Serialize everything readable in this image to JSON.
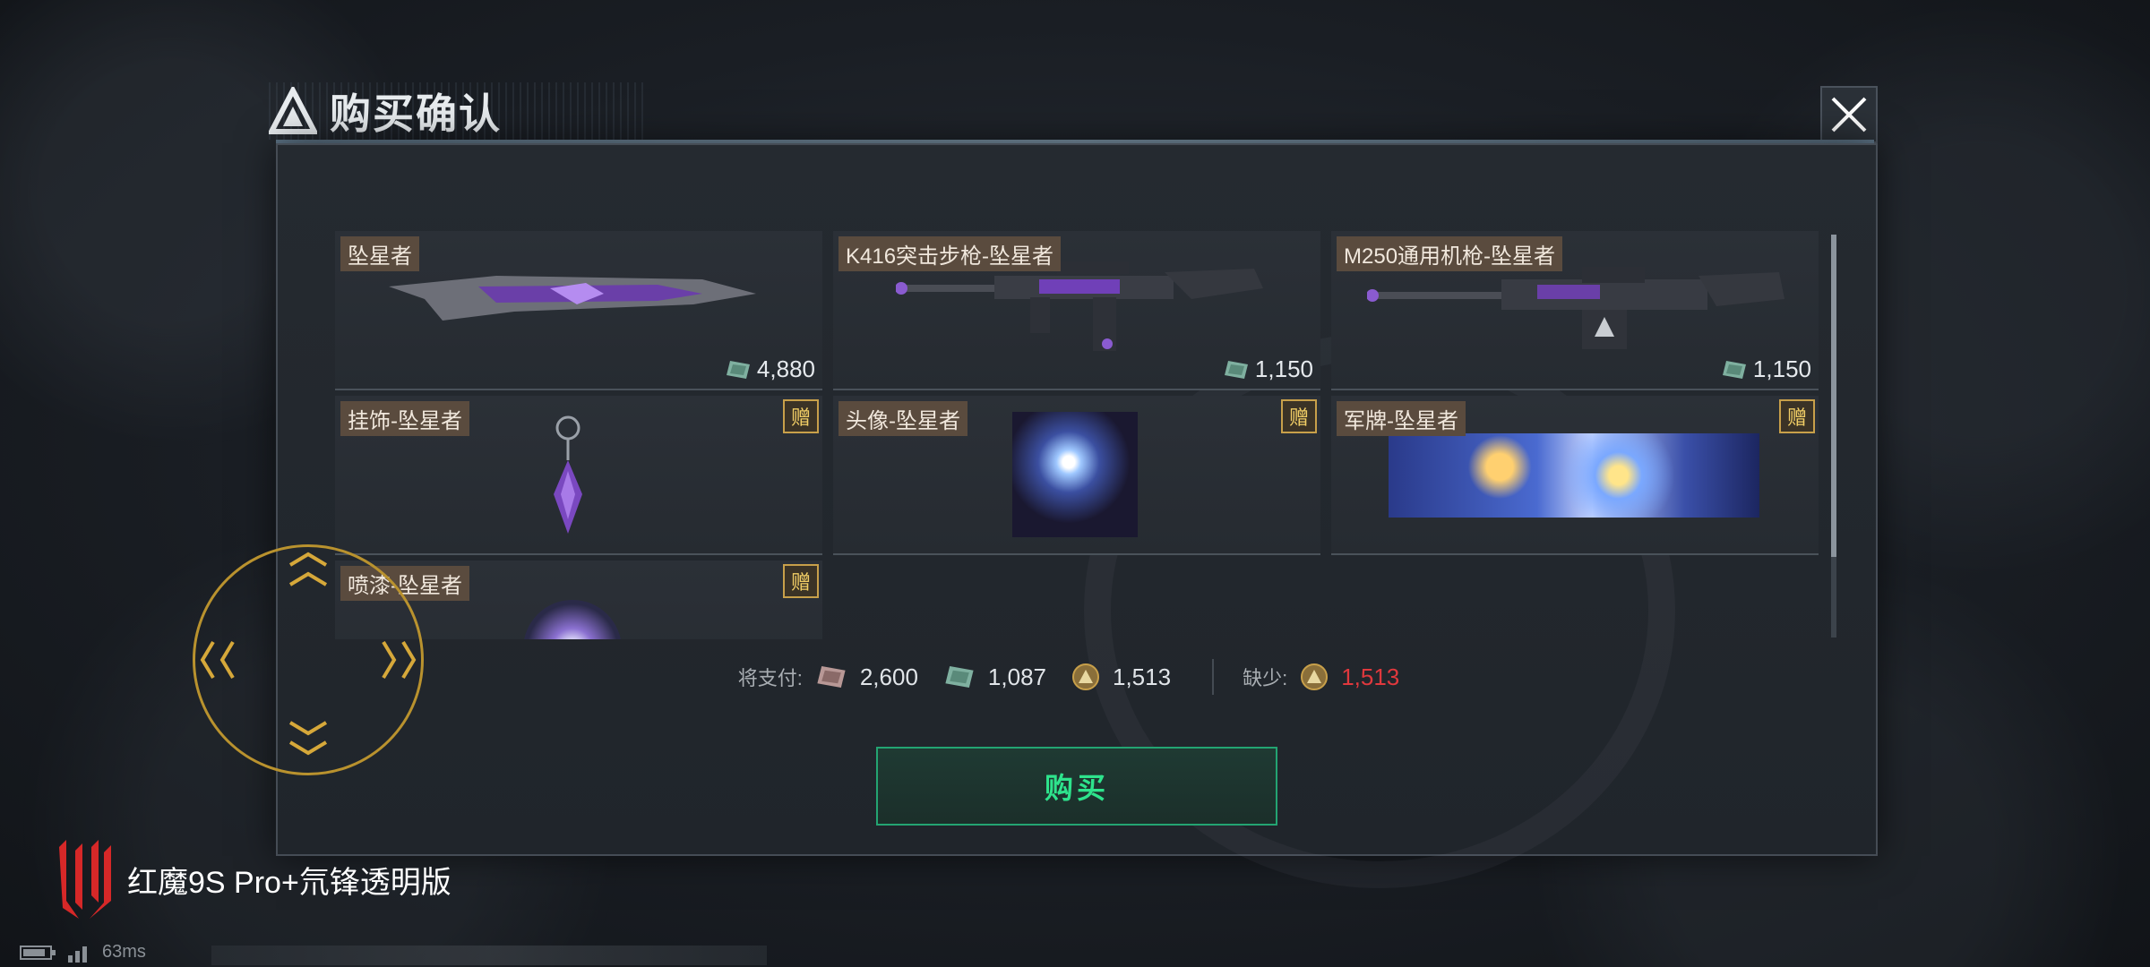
{
  "dialog": {
    "title": "购买确认",
    "close_icon": "close-icon"
  },
  "items": [
    {
      "label": "坠星者",
      "price": "4,880",
      "gift": false,
      "art": "dagger"
    },
    {
      "label": "K416突击步枪-坠星者",
      "price": "1,150",
      "gift": false,
      "art": "rifle"
    },
    {
      "label": "M250通用机枪-坠星者",
      "price": "1,150",
      "gift": false,
      "art": "machine-gun"
    },
    {
      "label": "挂饰-坠星者",
      "price": "",
      "gift": true,
      "gift_label": "赠",
      "art": "pendant"
    },
    {
      "label": "头像-坠星者",
      "price": "",
      "gift": true,
      "gift_label": "赠",
      "art": "avatar"
    },
    {
      "label": "军牌-坠星者",
      "price": "",
      "gift": true,
      "gift_label": "赠",
      "art": "dogtag"
    },
    {
      "label": "喷漆-坠星者",
      "price": "",
      "gift": true,
      "gift_label": "赠",
      "art": "spray"
    }
  ],
  "payment": {
    "pay_label": "将支付:",
    "costs": [
      {
        "currency": "red-ticket",
        "amount": "2,600"
      },
      {
        "currency": "green-ticket",
        "amount": "1,087"
      },
      {
        "currency": "gold-coin",
        "amount": "1,513"
      }
    ],
    "missing_label": "缺少:",
    "missing": {
      "currency": "gold-coin",
      "amount": "1,513"
    }
  },
  "buy_button": {
    "label": "购买"
  },
  "watermark": {
    "text": "红魔9S Pro+氘锋透明版"
  },
  "status": {
    "ping": "63ms"
  },
  "colors": {
    "accent_green": "#2ee38c",
    "warning_red": "#e0383d",
    "gold": "#c8a04a",
    "label_bg": "#5a4b3e"
  }
}
